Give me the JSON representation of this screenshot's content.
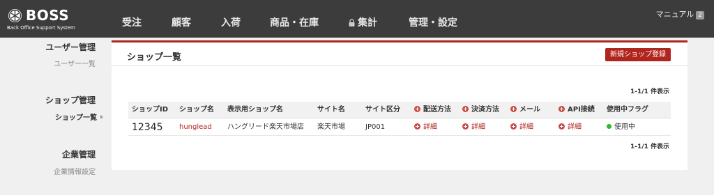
{
  "colors": {
    "accent": "#b0261e",
    "topbar": "#3c3c3c",
    "status_active": "#2eb82e"
  },
  "logo": {
    "title": "BOSS",
    "subtitle": "Back Office Support System",
    "icon": "boss-logo-icon"
  },
  "nav": {
    "items": [
      "受注",
      "顧客",
      "入荷",
      "商品・在庫",
      "集計",
      "管理・設定"
    ],
    "lock_icon": "lock-icon",
    "manual": {
      "label": "マニュアル",
      "badge": "2"
    }
  },
  "sidebar": {
    "sections": [
      {
        "heading": "ユーザー管理",
        "links": [
          "ユーザー一覧"
        ]
      },
      {
        "heading": "ショップ管理",
        "links": [
          "ショップ一覧"
        ]
      },
      {
        "heading": "企業管理",
        "links": [
          "企業情報設定"
        ]
      }
    ]
  },
  "main": {
    "title": "ショップ一覧",
    "new_button": "新規ショップ登録",
    "count_top": "1-1/1 件表示",
    "count_bottom": "1-1/1 件表示",
    "table": {
      "headers": [
        "ショップID",
        "ショップ名",
        "表示用ショップ名",
        "サイト名",
        "サイト区分",
        "配送方法",
        "決済方法",
        "メール",
        "API接続",
        "使用中フラグ"
      ],
      "rows": [
        {
          "id": "12345",
          "name": "hunglead",
          "display_name": "ハングリード楽天市場店",
          "site": "楽天市場",
          "site_type": "JP001",
          "shipping": "詳細",
          "payment": "詳細",
          "mail": "詳細",
          "api": "詳細",
          "status": "使用中"
        }
      ]
    }
  }
}
